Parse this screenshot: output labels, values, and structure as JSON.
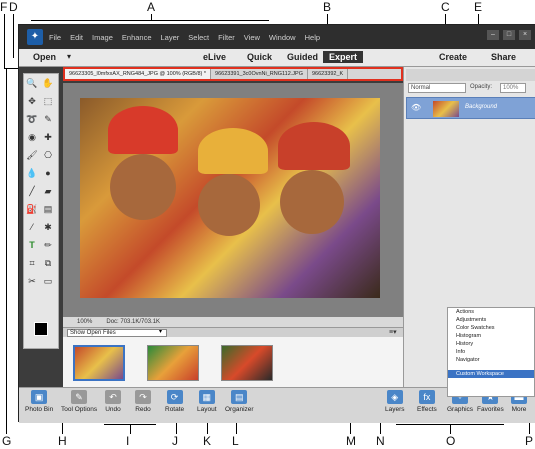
{
  "callouts": {
    "top": [
      "A",
      "B",
      "C",
      "E"
    ],
    "side": [
      "F",
      "D"
    ],
    "bottom": [
      "G",
      "H",
      "I",
      "J",
      "K",
      "L",
      "M",
      "N",
      "O",
      "P"
    ]
  },
  "app": {
    "menu": [
      "File",
      "Edit",
      "Image",
      "Enhance",
      "Layer",
      "Select",
      "Filter",
      "View",
      "Window",
      "Help"
    ],
    "open_label": "Open",
    "modes": [
      "eLive",
      "Quick",
      "Guided",
      "Expert"
    ],
    "create_label": "Create",
    "share_label": "Share"
  },
  "tabs": [
    "96623305_l0mfxxAX_RNG484_JPG @ 100% (RGB/8) *",
    "96623391_3c0OvnNi_RNG112.JPG",
    "96623392_K"
  ],
  "status": {
    "zoom": "100%",
    "doc": "Doc: 703.1K/703.1K"
  },
  "bin": {
    "select_label": "Show Open Files"
  },
  "layers": {
    "blend_mode": "Normal",
    "opacity_label": "Opacity:",
    "opacity_value": "100%",
    "layer_name": "Background"
  },
  "more_menu": [
    "Actions",
    "Adjustments",
    "Color Swatches",
    "Histogram",
    "History",
    "Info",
    "Navigator",
    "Custom Workspace"
  ],
  "bottom": {
    "photo_bin": "Photo Bin",
    "tool_options": "Tool Options",
    "undo": "Undo",
    "redo": "Redo",
    "rotate": "Rotate",
    "layout": "Layout",
    "organizer": "Organizer",
    "layers": "Layers",
    "effects": "Effects",
    "graphics": "Graphics",
    "favorites": "Favorites",
    "more": "More"
  }
}
